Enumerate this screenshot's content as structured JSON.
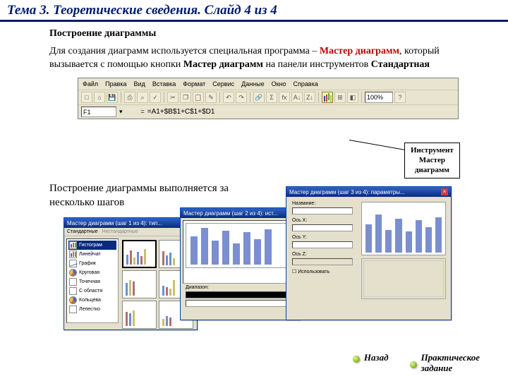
{
  "title": "Тема 3. Теоретические сведения. Слайд 4 из 4",
  "subhead": "Построение диаграммы",
  "para_parts": {
    "p1": "Для создания диаграмм  используется специальная программа – ",
    "p2_accent": "Мастер диаграмм",
    "p3": ", который вызывается с помощью кнопки ",
    "p4_bold": "Мастер диаграмм",
    "p5": "  на панели инструментов ",
    "p6_bold": "Стандартная"
  },
  "toolbar": {
    "menu": [
      "Файл",
      "Правка",
      "Вид",
      "Вставка",
      "Формат",
      "Сервис",
      "Данные",
      "Окно",
      "Справка"
    ],
    "zoom": "100%",
    "cellref": "F1",
    "formula": "=A1+$B$1+C$1+$D1"
  },
  "callout": {
    "l1": "Инструмент",
    "l2": "Мастер",
    "l3": "диаграмм"
  },
  "steps_text": "Построение диаграммы выполняется за несколько шагов",
  "wizards": {
    "w1": {
      "title": "Мастер диаграмм (шаг 1 из 4): тип...",
      "tab1": "Стандартные",
      "tab2": "Нестандартные",
      "types": [
        "Гистограм",
        "Линейчат",
        "График",
        "Круговая",
        "Точечная",
        "С областя",
        "Кольцева",
        "Лепестко"
      ]
    },
    "w2": {
      "title": "Мастер диаграмм (шаг 2 из 4): ист...",
      "field_label": "Диапазон:"
    },
    "w3": {
      "title": "Мастер диаграмм (шаг 3 из 4): параметры...",
      "labels": [
        "Название:",
        "Ось X:",
        "Ось Y:",
        "Ось Z:"
      ],
      "checkbox": "Использовать"
    }
  },
  "nav": {
    "back": "Назад",
    "task_l1": "Практическое",
    "task_l2": "задание"
  }
}
